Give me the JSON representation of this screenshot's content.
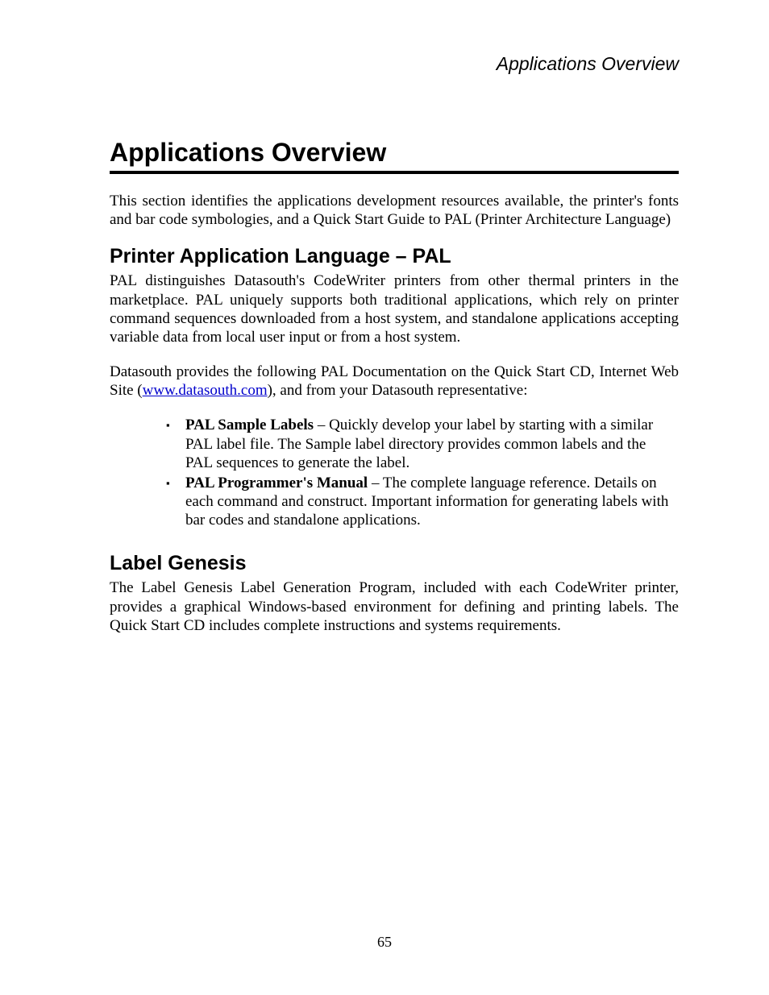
{
  "header": {
    "running": "Applications Overview"
  },
  "chapter": {
    "title": "Applications Overview"
  },
  "intro": {
    "p1": "This section identifies the applications development resources available, the printer's fonts and bar code symbologies, and a Quick Start Guide to PAL (Printer Architecture Language)"
  },
  "pal": {
    "heading": "Printer Application Language – PAL",
    "p1": "PAL distinguishes Datasouth's CodeWriter printers from other thermal printers in the marketplace. PAL uniquely supports both traditional applications, which rely on printer command sequences downloaded from a host system, and standalone applications accepting variable data from local user input or from a host system.",
    "p2a": "Datasouth provides the following PAL Documentation on the Quick Start CD, Internet Web Site (",
    "link": "www.datasouth.com",
    "p2b": "), and from your Datasouth representative:",
    "bullets": [
      {
        "bold": "PAL Sample Labels",
        "rest": " – Quickly develop your label by starting with a similar PAL label file. The Sample label directory provides common labels and the PAL sequences to generate the label."
      },
      {
        "bold": "PAL Programmer's Manual",
        "rest": " – The complete language reference. Details on each command and construct. Important information for generating labels with bar codes and standalone applications."
      }
    ]
  },
  "labelgenesis": {
    "heading": "Label Genesis",
    "p1": "The Label Genesis Label Generation Program, included with each CodeWriter printer, provides a graphical Windows-based environment for defining and printing labels. The Quick Start CD includes complete instructions and systems requirements."
  },
  "footer": {
    "page": "65"
  }
}
